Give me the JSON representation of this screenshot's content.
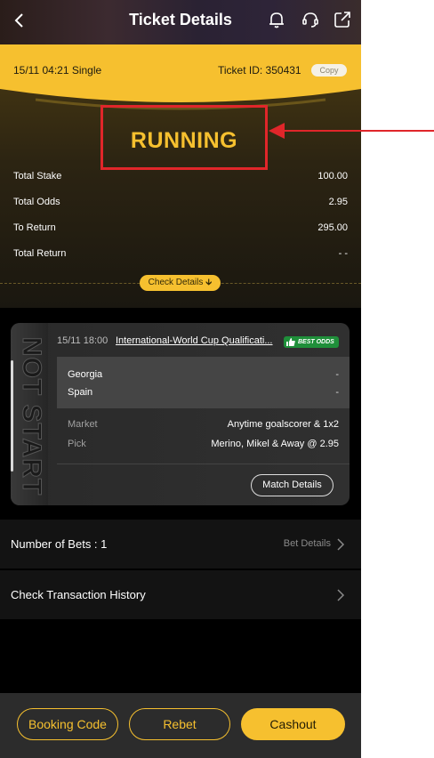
{
  "header": {
    "title": "Ticket Details",
    "back_icon": "chevron-left-icon",
    "icons": [
      "bell-icon",
      "headset-icon",
      "share-icon"
    ]
  },
  "ticket": {
    "date_type": "15/11 04:21 Single",
    "ticket_id": "Ticket ID: 350431",
    "copy_label": "Copy",
    "status": "RUNNING",
    "summary": [
      {
        "label": "Total Stake",
        "value": "100.00"
      },
      {
        "label": "Total Odds",
        "value": "2.95"
      },
      {
        "label": "To Return",
        "value": "295.00"
      },
      {
        "label": "Total Return",
        "value": "- -"
      }
    ],
    "check_details": "Check Details"
  },
  "match": {
    "status_vertical": "NOT START",
    "time": "15/11 18:00",
    "name": "International-World Cup Qualificati...",
    "best_odds": "BEST ODDS",
    "teams": [
      {
        "name": "Georgia",
        "value": "-"
      },
      {
        "name": "Spain",
        "value": "-"
      }
    ],
    "market_label": "Market",
    "market_value": "Anytime goalscorer & 1x2",
    "pick_label": "Pick",
    "pick_value": "Merino, Mikel & Away @ 2.95",
    "details_button": "Match Details"
  },
  "bets": {
    "label": "Number of Bets :  1",
    "link": "Bet Details"
  },
  "history": {
    "label": "Check Transaction History"
  },
  "bottom": {
    "booking": "Booking Code",
    "rebet": "Rebet",
    "cashout": "Cashout"
  },
  "colors": {
    "accent": "#f6c02f",
    "annotation": "#e0262a",
    "background": "#000000"
  }
}
